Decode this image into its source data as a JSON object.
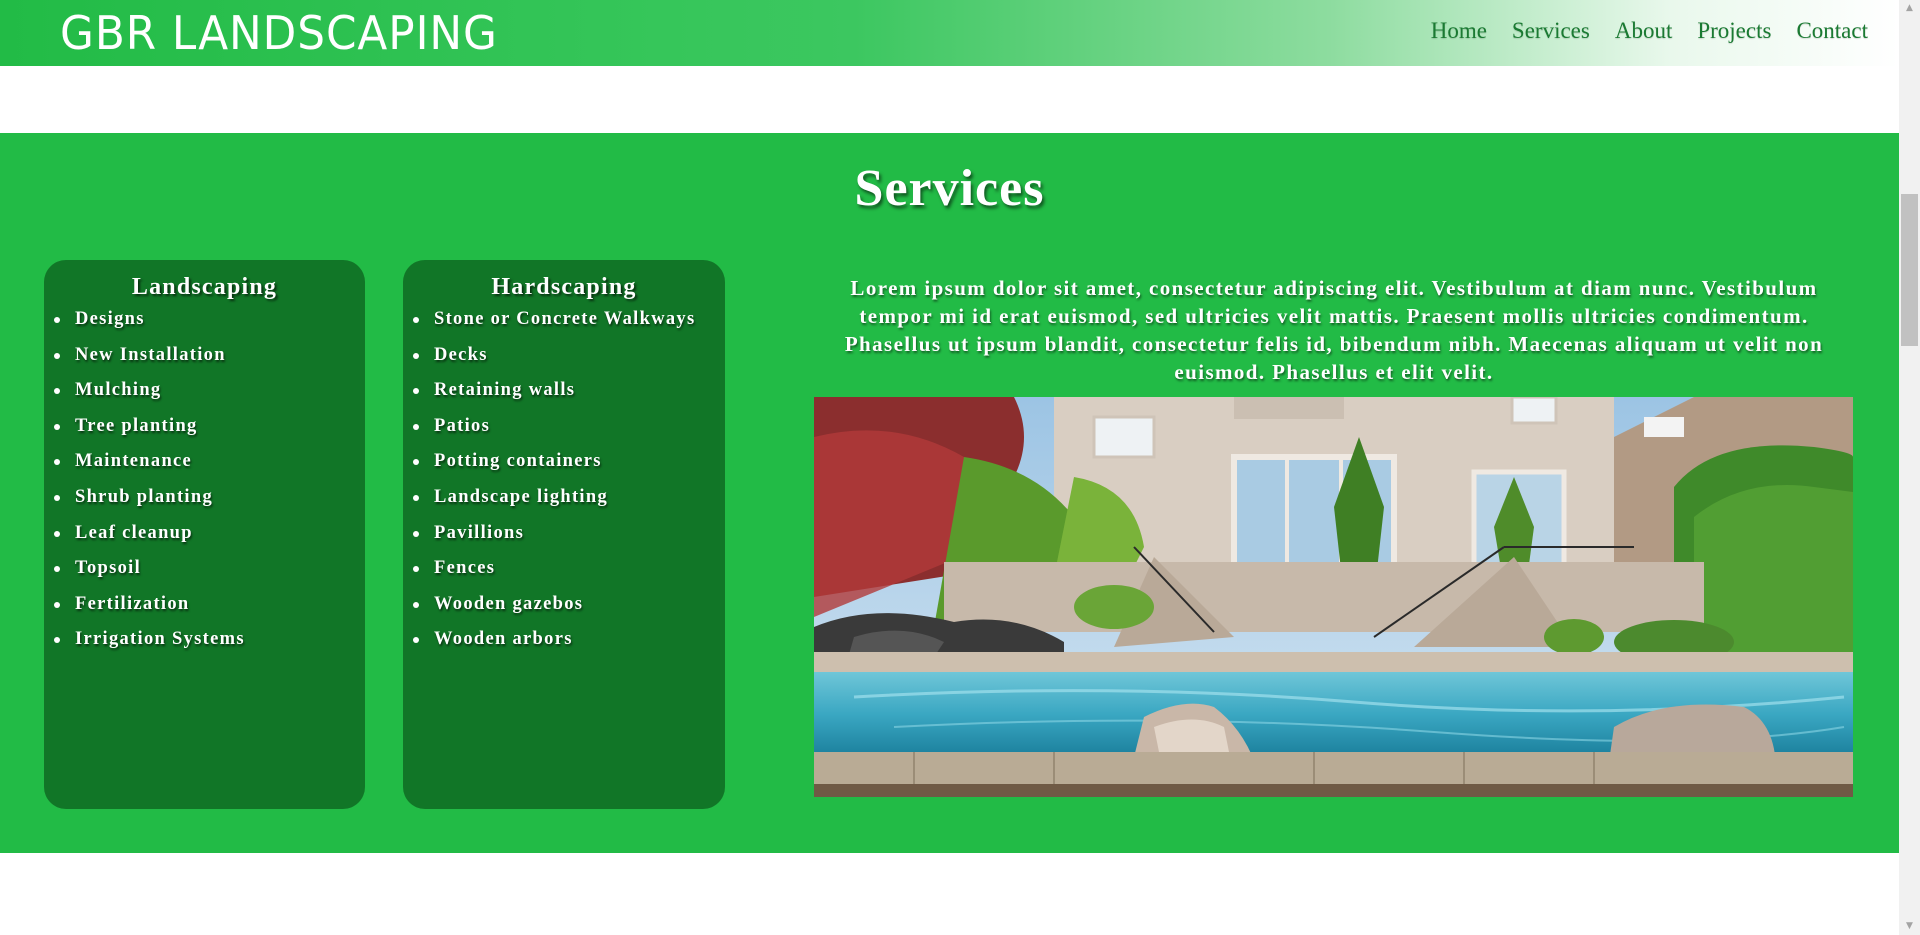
{
  "header": {
    "logo": "GBR LANDSCAPING",
    "nav": [
      "Home",
      "Services",
      "About",
      "Projects",
      "Contact"
    ]
  },
  "services": {
    "title": "Services",
    "landscaping": {
      "heading": "Landscaping",
      "items": [
        "Designs",
        "New Installation",
        "Mulching",
        "Tree planting",
        "Maintenance",
        "Shrub planting",
        "Leaf cleanup",
        "Topsoil",
        "Fertilization",
        "Irrigation Systems"
      ]
    },
    "hardscaping": {
      "heading": "Hardscaping",
      "items": [
        "Stone or Concrete Walkways",
        "Decks",
        "Retaining walls",
        "Patios",
        "Potting containers",
        "Landscape lighting",
        "Pavillions",
        "Fences",
        "Wooden gazebos",
        "Wooden arbors"
      ]
    },
    "description": "Lorem ipsum dolor sit amet, consectetur adipiscing elit. Vestibulum at diam nunc. Vestibulum tempor mi id erat euismod, sed ultricies velit mattis. Praesent mollis ultricies condimentum. Phasellus ut ipsum blandit, consectetur felis id, bibendum nibh. Maecenas aliquam ut velit non euismod. Phasellus et elit velit."
  },
  "scrollbar": {
    "up_icon": "triangle-up",
    "down_icon": "triangle-down"
  },
  "colors": {
    "brand_green": "#22bb46",
    "card_green": "#117627",
    "nav_text": "#1a7a32"
  }
}
